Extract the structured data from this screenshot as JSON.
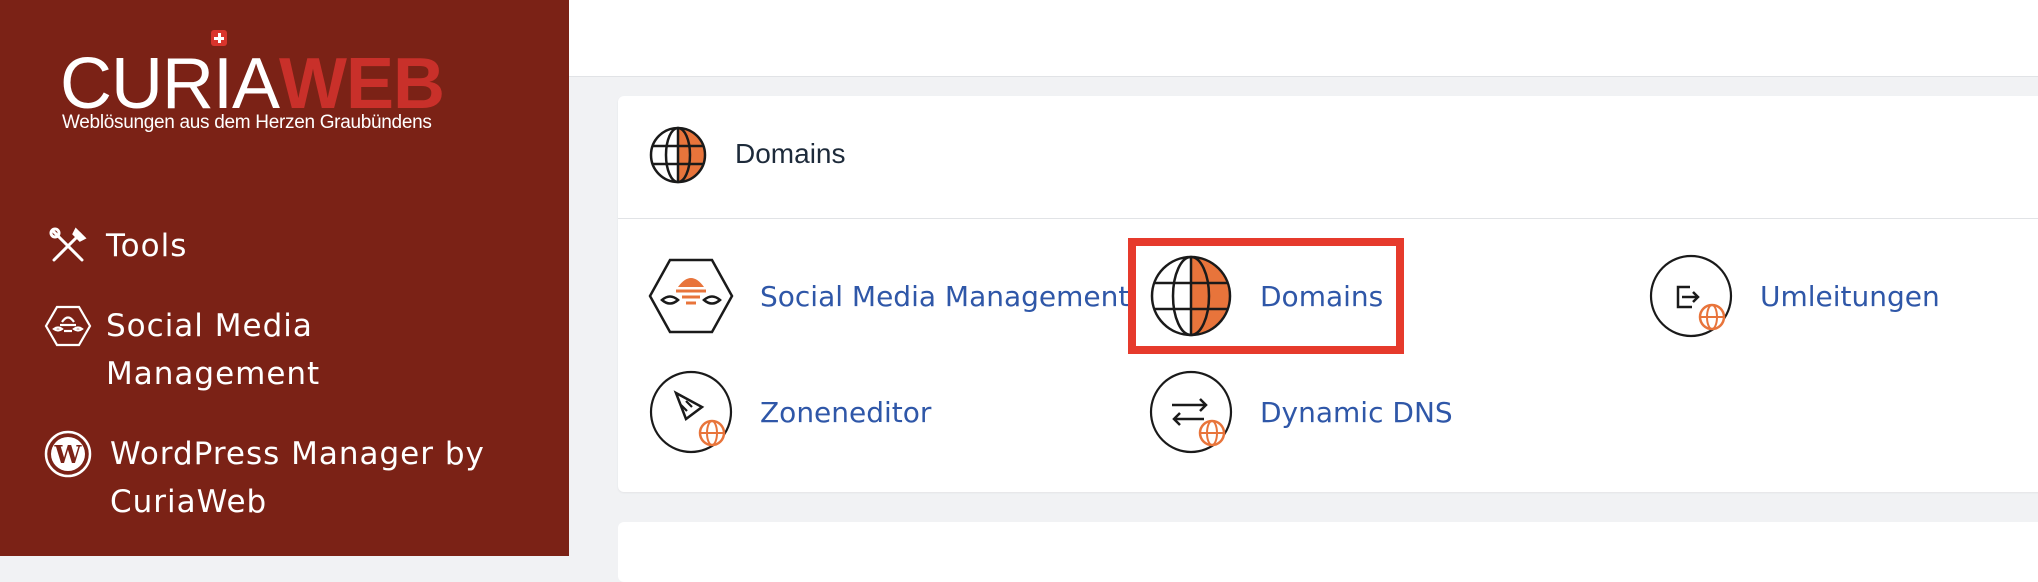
{
  "brand": {
    "logo_part1": "CURIA",
    "logo_part2": "WEB",
    "tagline": "Weblösungen aus dem Herzen Graubündens"
  },
  "sidebar": {
    "items": [
      {
        "label": "Tools",
        "icon": "tools-icon"
      },
      {
        "label": "Social Media Management",
        "icon": "social-media-icon"
      },
      {
        "label": "WordPress Manager by CuriaWeb",
        "icon": "wordpress-icon"
      }
    ]
  },
  "panel": {
    "title": "Domains",
    "icon": "globe-icon",
    "items": [
      {
        "label": "Social Media Management",
        "icon": "social-media-icon"
      },
      {
        "label": "Domains",
        "icon": "globe-icon",
        "highlighted": true
      },
      {
        "label": "Umleitungen",
        "icon": "redirect-icon"
      },
      {
        "label": "Zoneneditor",
        "icon": "zone-editor-icon"
      },
      {
        "label": "Dynamic DNS",
        "icon": "dynamic-dns-icon"
      }
    ]
  },
  "colors": {
    "sidebar_bg": "#7b2216",
    "accent_orange": "#e8743b",
    "link_blue": "#2f57a8",
    "highlight_red": "#e63a2c"
  }
}
